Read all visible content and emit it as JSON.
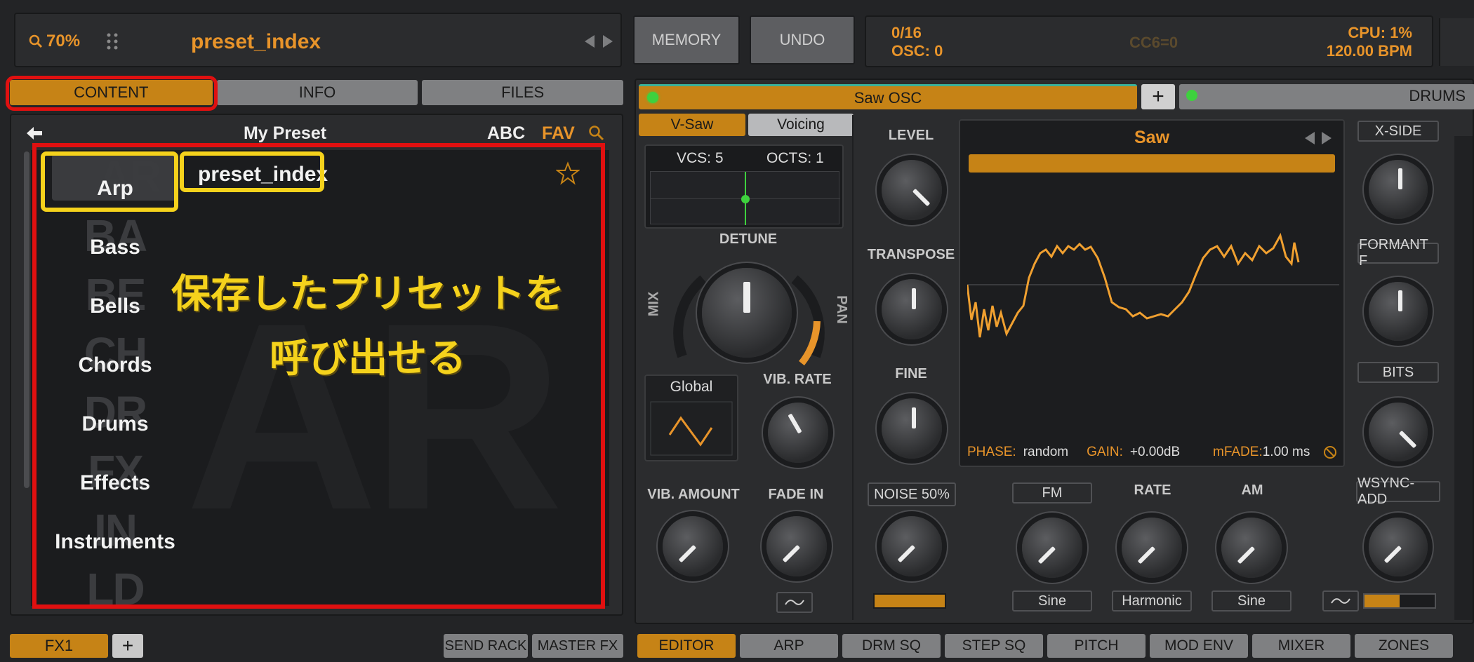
{
  "header": {
    "zoom": "70%",
    "preset_name": "preset_index",
    "memory_label": "MEMORY",
    "undo_label": "UNDO",
    "status_voices": "0/16",
    "status_osc": "OSC: 0",
    "status_cc": "CC6=0",
    "status_cpu": "CPU:  1%",
    "status_bpm": "120.00 BPM"
  },
  "browser": {
    "tabs": [
      "CONTENT",
      "INFO",
      "FILES"
    ],
    "title": "My Preset",
    "sort_abc": "ABC",
    "sort_fav": "FAV",
    "selected_preset": "preset_index",
    "categories": [
      {
        "abbr": "AR",
        "name": "Arp"
      },
      {
        "abbr": "BA",
        "name": "Bass"
      },
      {
        "abbr": "BE",
        "name": "Bells"
      },
      {
        "abbr": "CH",
        "name": "Chords"
      },
      {
        "abbr": "DR",
        "name": "Drums"
      },
      {
        "abbr": "FX",
        "name": "Effects"
      },
      {
        "abbr": "IN",
        "name": "Instruments"
      },
      {
        "abbr": "LD",
        "name": ""
      }
    ],
    "watermark": "AR",
    "annotation_line1": "保存したプリセットを",
    "annotation_line2": "呼び出せる"
  },
  "fx_bar": {
    "tab": "FX1",
    "add": "+",
    "send_rack": "SEND RACK",
    "master_fx": "MASTER FX"
  },
  "osc": {
    "tab_name": "Saw OSC",
    "add": "+",
    "second_tab": "DRUMS",
    "subtabs": [
      "V-Saw",
      "Voicing"
    ],
    "vcs": "VCS: 5",
    "octs": "OCTS: 1",
    "detune_label": "DETUNE",
    "mix_label": "MIX",
    "pan_label": "PAN",
    "global_label": "Global",
    "vib_rate_label": "VIB. RATE",
    "vib_amount_label": "VIB. AMOUNT",
    "fade_in_label": "FADE IN",
    "level_label": "LEVEL",
    "transpose_label": "TRANSPOSE",
    "fine_label": "FINE",
    "noise_label": "NOISE 50%",
    "wave_name": "Saw",
    "phase_label": "PHASE:",
    "phase_value": "random",
    "gain_label": "GAIN:",
    "gain_value": "+0.00dB",
    "mfade_label": "mFADE:",
    "mfade_value": "1.00 ms",
    "fm_label": "FM",
    "rate_label": "RATE",
    "am_label": "AM",
    "fm_wave": "Sine",
    "rate_wave": "Harmonic",
    "am_wave": "Sine",
    "xside_label": "X-SIDE",
    "formant_label": "FORMANT F",
    "bits_label": "BITS",
    "wsync_label": "WSYNC-ADD"
  },
  "bottom_tabs": [
    "EDITOR",
    "ARP",
    "DRM SQ",
    "STEP SQ",
    "PITCH",
    "MOD ENV",
    "MIXER",
    "ZONES"
  ],
  "colors": {
    "accent": "#c68316",
    "orange_text": "#e8942a",
    "highlight_red": "#e01010",
    "highlight_yellow": "#f5d21c",
    "led_green": "#3ed13e"
  }
}
